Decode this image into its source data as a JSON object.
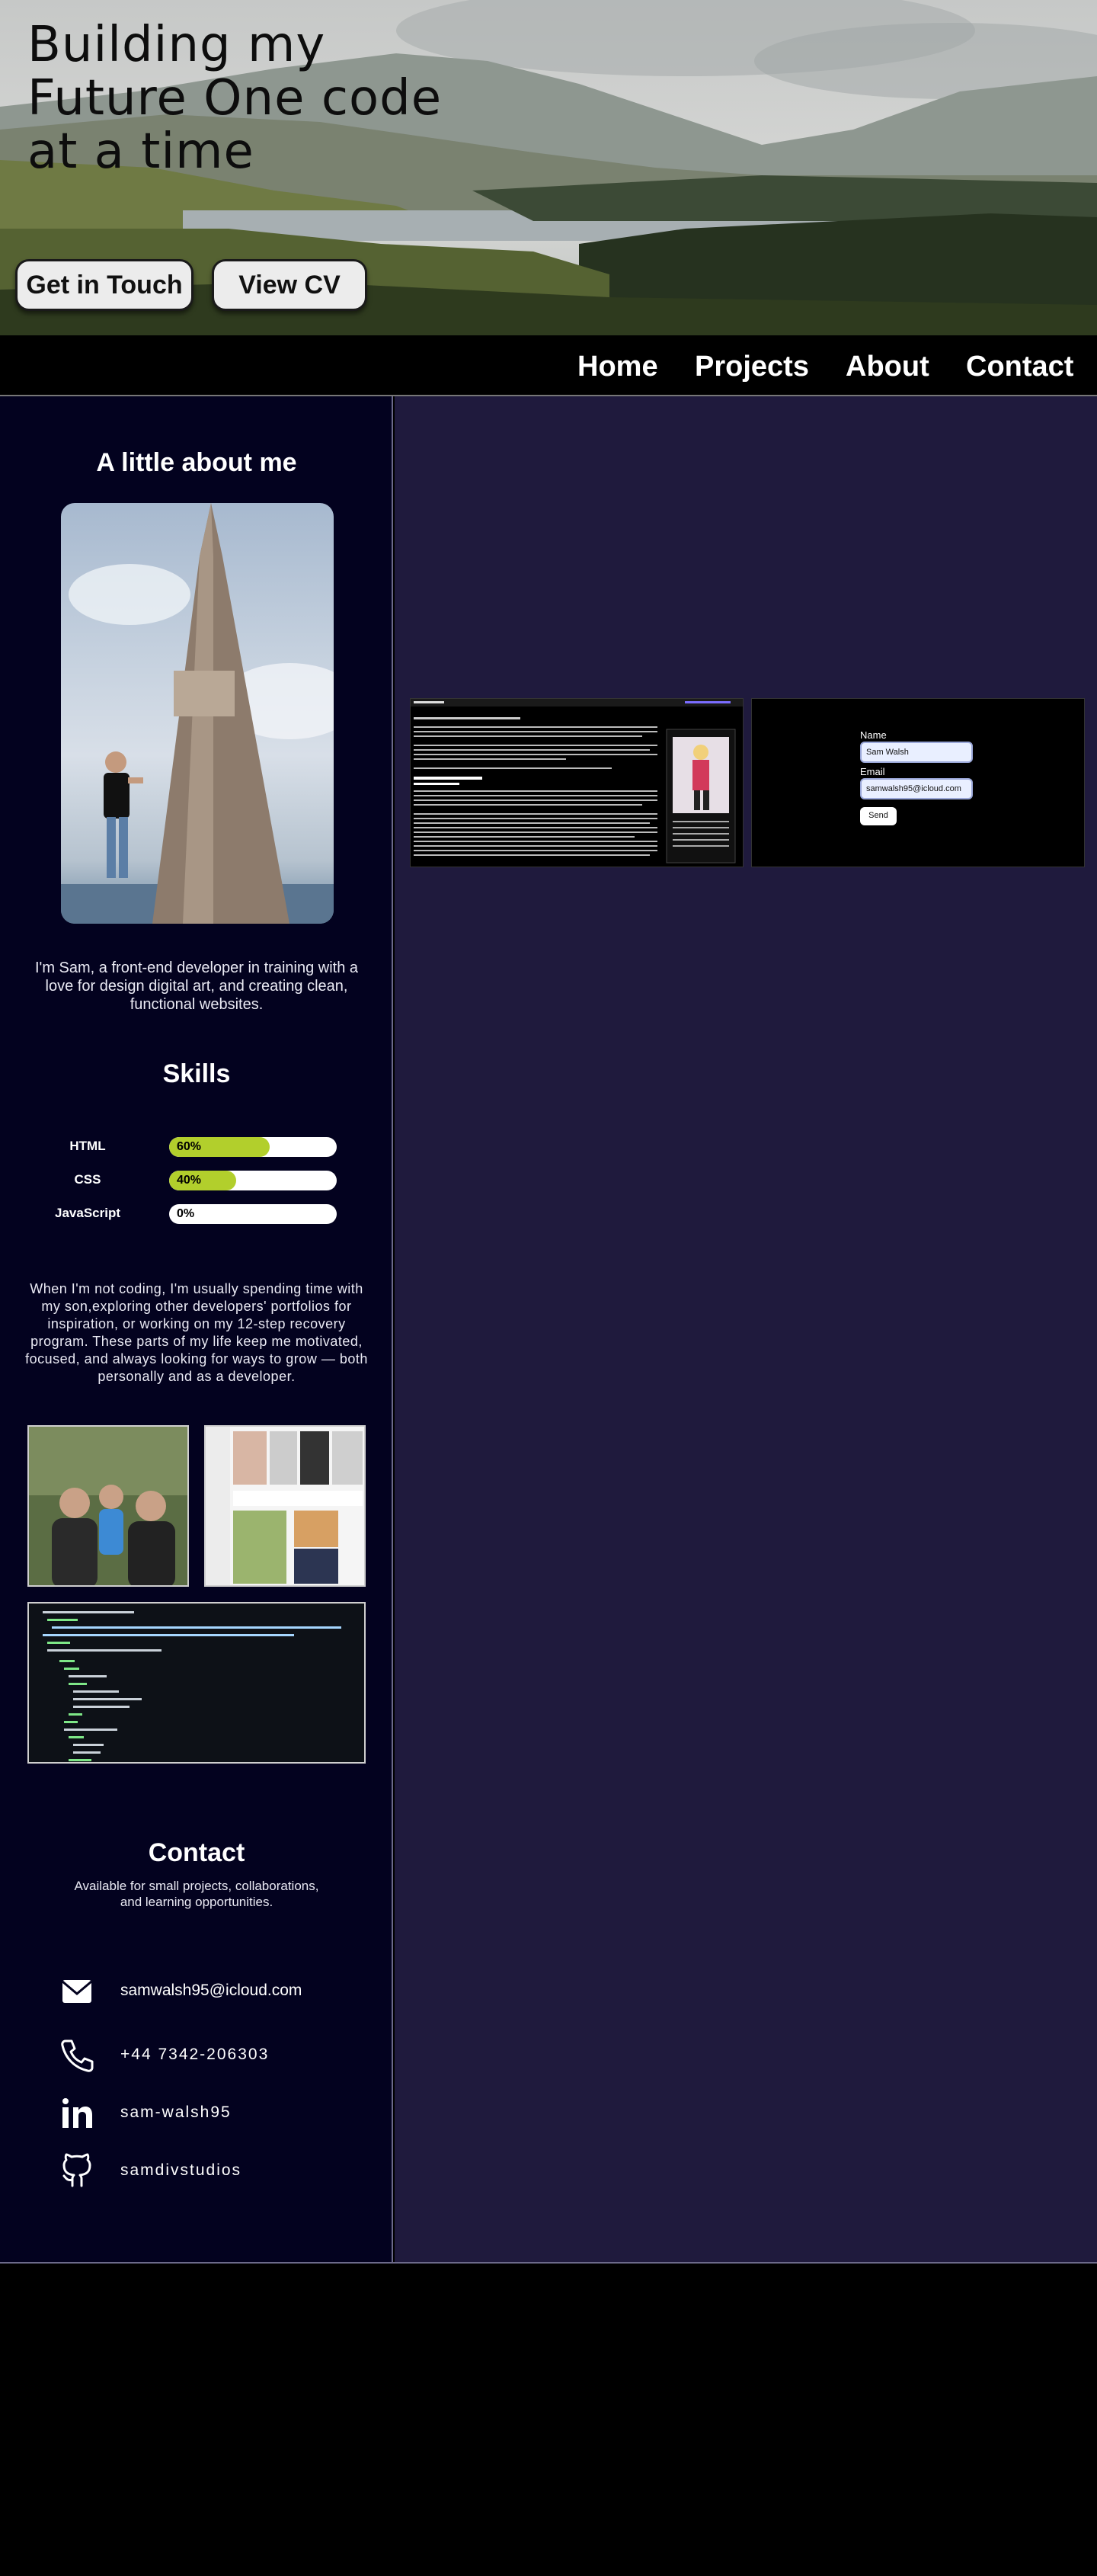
{
  "hero": {
    "title": "Building my Future One code at a time",
    "buttons": {
      "touch": "Get in Touch",
      "cv": "View CV"
    }
  },
  "nav": {
    "items": [
      "Home",
      "Projects",
      "About",
      "Contact"
    ]
  },
  "about": {
    "heading": "A little about me",
    "intro": "I'm Sam, a front-end developer in training with a love for design digital art, and creating clean, functional websites."
  },
  "skills": {
    "heading": "Skills",
    "items": [
      {
        "name": "HTML",
        "percent": 60,
        "label": "60%"
      },
      {
        "name": "CSS",
        "percent": 40,
        "label": "40%"
      },
      {
        "name": "JavaScript",
        "percent": 0,
        "label": "0%"
      }
    ]
  },
  "personal": {
    "text": "When I'm not coding, I'm usually spending time with my son,exploring other developers' portfolios for inspiration, or working on my 12-step recovery program. These parts of my life keep me motivated, focused, and always looking for ways to grow — both personally and as a developer."
  },
  "contact": {
    "heading": "Contact",
    "subtitle": "Available for small projects, collaborations, and learning opportunities.",
    "items": [
      {
        "icon": "mail-icon",
        "text": "samwalsh95@icloud.com"
      },
      {
        "icon": "phone-icon",
        "text": "+44 7342-206303"
      },
      {
        "icon": "linkedin-icon",
        "text": "sam-walsh95"
      },
      {
        "icon": "github-icon",
        "text": "samdivstudios"
      }
    ]
  },
  "projects": {
    "form_preview": {
      "name_label": "Name",
      "name_value": "Sam Walsh",
      "email_label": "Email",
      "email_value": "samwalsh95@icloud.com",
      "send_label": "Send"
    }
  },
  "colors": {
    "sidebar_bg": "#03021f",
    "main_bg": "#1f1a3d",
    "skill_fill": "#b2cf2c",
    "nav_bg": "#000000"
  }
}
